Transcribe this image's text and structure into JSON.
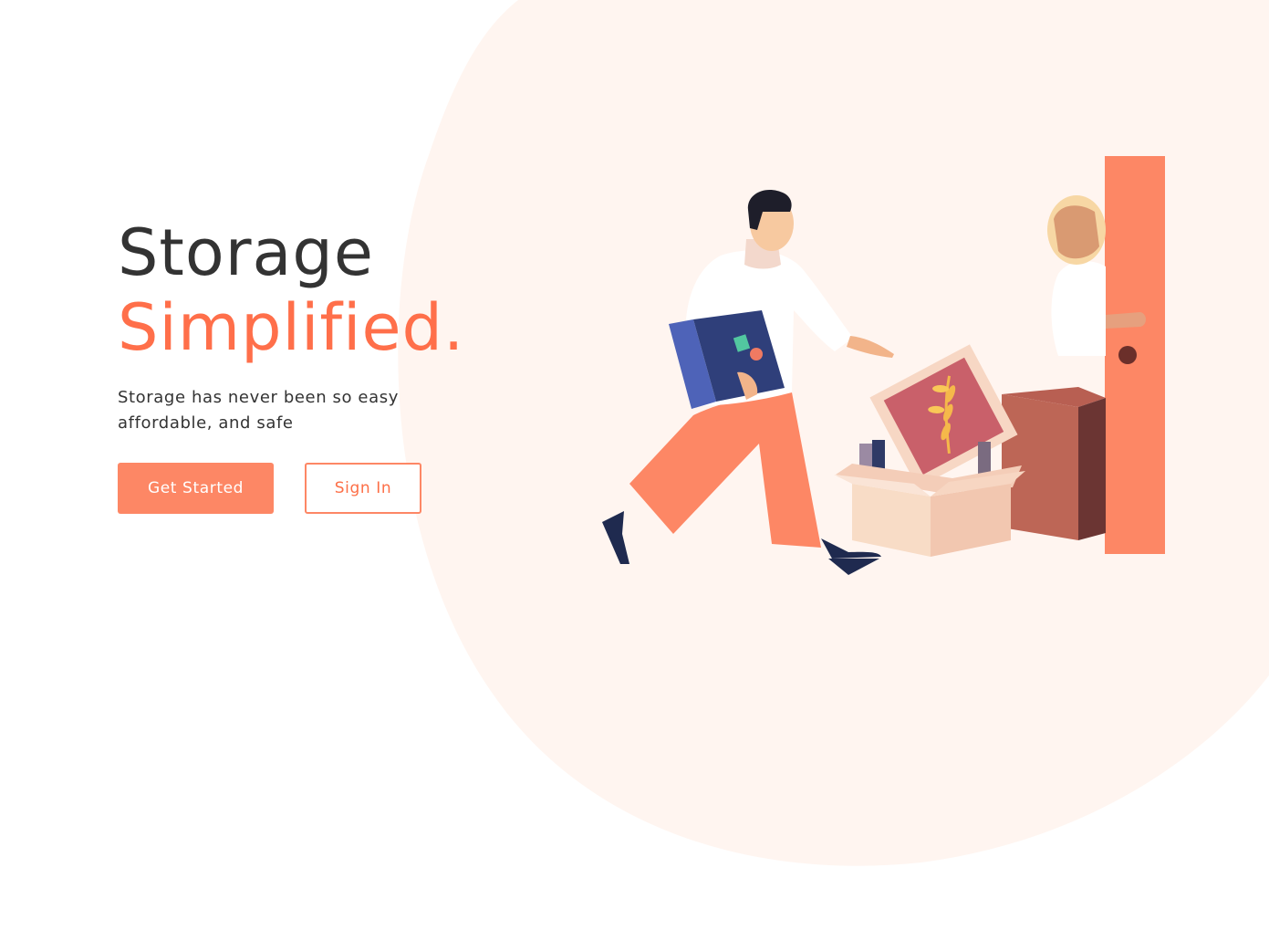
{
  "hero": {
    "title_line1": "Storage",
    "title_line2": "Simplified.",
    "subtitle_line1": "Storage has never been so easy",
    "subtitle_line2": "affordable, and safe"
  },
  "actions": {
    "primary_label": "Get Started",
    "secondary_label": "Sign In"
  },
  "colors": {
    "accent": "#ff6f4a",
    "button": "#fd8765",
    "heading": "#333333",
    "blob": "#fff5f0"
  },
  "illustration": {
    "icon": "moving-people-illustration"
  }
}
